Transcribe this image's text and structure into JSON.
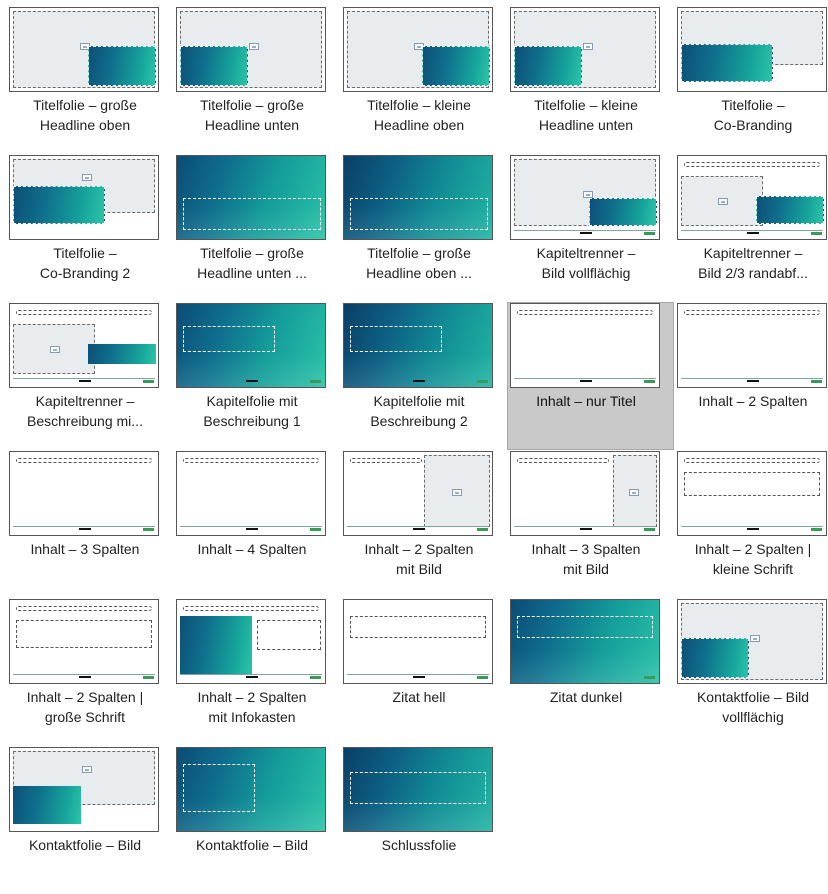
{
  "layouts": [
    {
      "label": "Titelfolie – große\nHeadline oben",
      "kind": "gray-grad-br",
      "selected": false
    },
    {
      "label": "Titelfolie – große\nHeadline unten",
      "kind": "gray-grad-bl",
      "selected": false
    },
    {
      "label": "Titelfolie – kleine\nHeadline oben",
      "kind": "gray-grad-br",
      "selected": false
    },
    {
      "label": "Titelfolie – kleine\nHeadline unten",
      "kind": "gray-grad-bl",
      "selected": false
    },
    {
      "label": "Titelfolie –\nCo-Branding",
      "kind": "cobrand",
      "selected": false
    },
    {
      "label": "Titelfolie –\nCo-Branding 2",
      "kind": "cobrand2",
      "selected": false
    },
    {
      "label": "Titelfolie – große\nHeadline unten ...",
      "kind": "full-bottom",
      "selected": false
    },
    {
      "label": "Titelfolie – große\nHeadline oben ...",
      "kind": "full-bottom-dark",
      "selected": false
    },
    {
      "label": "Kapiteltrenner –\nBild vollflächig",
      "kind": "kap-full",
      "selected": false
    },
    {
      "label": "Kapiteltrenner –\nBild 2/3 randabf...",
      "kind": "kap-23",
      "selected": false
    },
    {
      "label": "Kapiteltrenner –\nBeschreibung mi...",
      "kind": "kap-desc",
      "selected": false
    },
    {
      "label": "Kapitelfolie mit\nBeschreibung 1",
      "kind": "kapf1",
      "selected": false
    },
    {
      "label": "Kapitelfolie mit\nBeschreibung 2",
      "kind": "kapf2",
      "selected": false
    },
    {
      "label": "Inhalt – nur Titel",
      "kind": "content",
      "selected": true
    },
    {
      "label": "Inhalt – 2 Spalten",
      "kind": "content",
      "selected": false
    },
    {
      "label": "Inhalt – 3 Spalten",
      "kind": "content",
      "selected": false
    },
    {
      "label": "Inhalt – 4 Spalten",
      "kind": "content",
      "selected": false
    },
    {
      "label": "Inhalt – 2 Spalten\nmit Bild",
      "kind": "content-img2",
      "selected": false
    },
    {
      "label": "Inhalt – 3 Spalten\nmit Bild",
      "kind": "content-img3",
      "selected": false
    },
    {
      "label": "Inhalt – 2 Spalten |\nkleine Schrift",
      "kind": "content-small",
      "selected": false
    },
    {
      "label": "Inhalt – 2 Spalten |\ngroße Schrift",
      "kind": "content-big",
      "selected": false
    },
    {
      "label": "Inhalt – 2 Spalten\nmit Infokasten",
      "kind": "content-info",
      "selected": false
    },
    {
      "label": "Zitat hell",
      "kind": "zitat-hell",
      "selected": false
    },
    {
      "label": "Zitat dunkel",
      "kind": "zitat-dunkel",
      "selected": false
    },
    {
      "label": "Kontaktfolie – Bild\nvollflächig",
      "kind": "kontakt-full",
      "selected": false
    },
    {
      "label": "Kontaktfolie – Bild\n",
      "kind": "kontakt-2",
      "selected": false
    },
    {
      "label": "Kontaktfolie – Bild\n",
      "kind": "kontakt-3",
      "selected": false
    },
    {
      "label": "Schlussfolie\n",
      "kind": "schluss",
      "selected": false
    }
  ]
}
